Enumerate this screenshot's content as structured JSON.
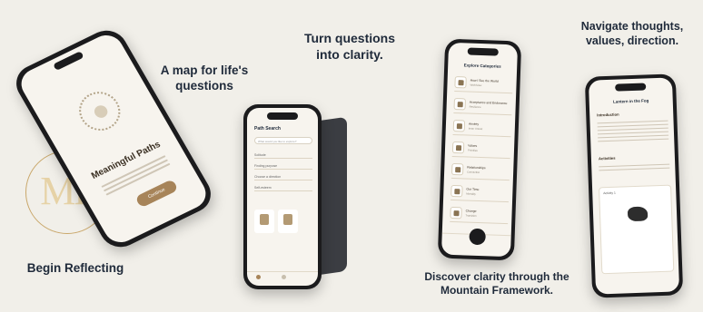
{
  "captions": {
    "map": "A map for life's questions",
    "turn": "Turn questions into clarity.",
    "navigate": "Navigate thoughts, values, direction.",
    "begin": "Begin Reflecting",
    "discover": "Discover clarity through the Mountain Framework."
  },
  "logo": {
    "text": "MF"
  },
  "phone1": {
    "title": "Meaningful Paths",
    "button": "Continue"
  },
  "phone2": {
    "header": "Path Search",
    "search_placeholder": "What would you like to explore?",
    "rows": [
      "Solitude",
      "Finding purpose",
      "Choose a direction",
      "Self-esteem"
    ]
  },
  "phone3": {
    "header": "Explore Categories",
    "items": [
      {
        "title": "How I See the World",
        "sub": "Worldview"
      },
      {
        "title": "Acceptance and Endurance",
        "sub": "Resilience"
      },
      {
        "title": "Anxiety",
        "sub": "Inner Unrest"
      },
      {
        "title": "Values",
        "sub": "Priorities"
      },
      {
        "title": "Relationships",
        "sub": "Connection"
      },
      {
        "title": "Our Time",
        "sub": "Mortality"
      },
      {
        "title": "Change",
        "sub": "Transition"
      }
    ]
  },
  "phone4": {
    "title": "Lantern in the Fog",
    "intro": "Introduction",
    "activities": "Activities",
    "activity": "Activity 1"
  },
  "colors": {
    "accent": "#a78459",
    "background": "#f1efe9",
    "text": "#1f2a3a"
  }
}
